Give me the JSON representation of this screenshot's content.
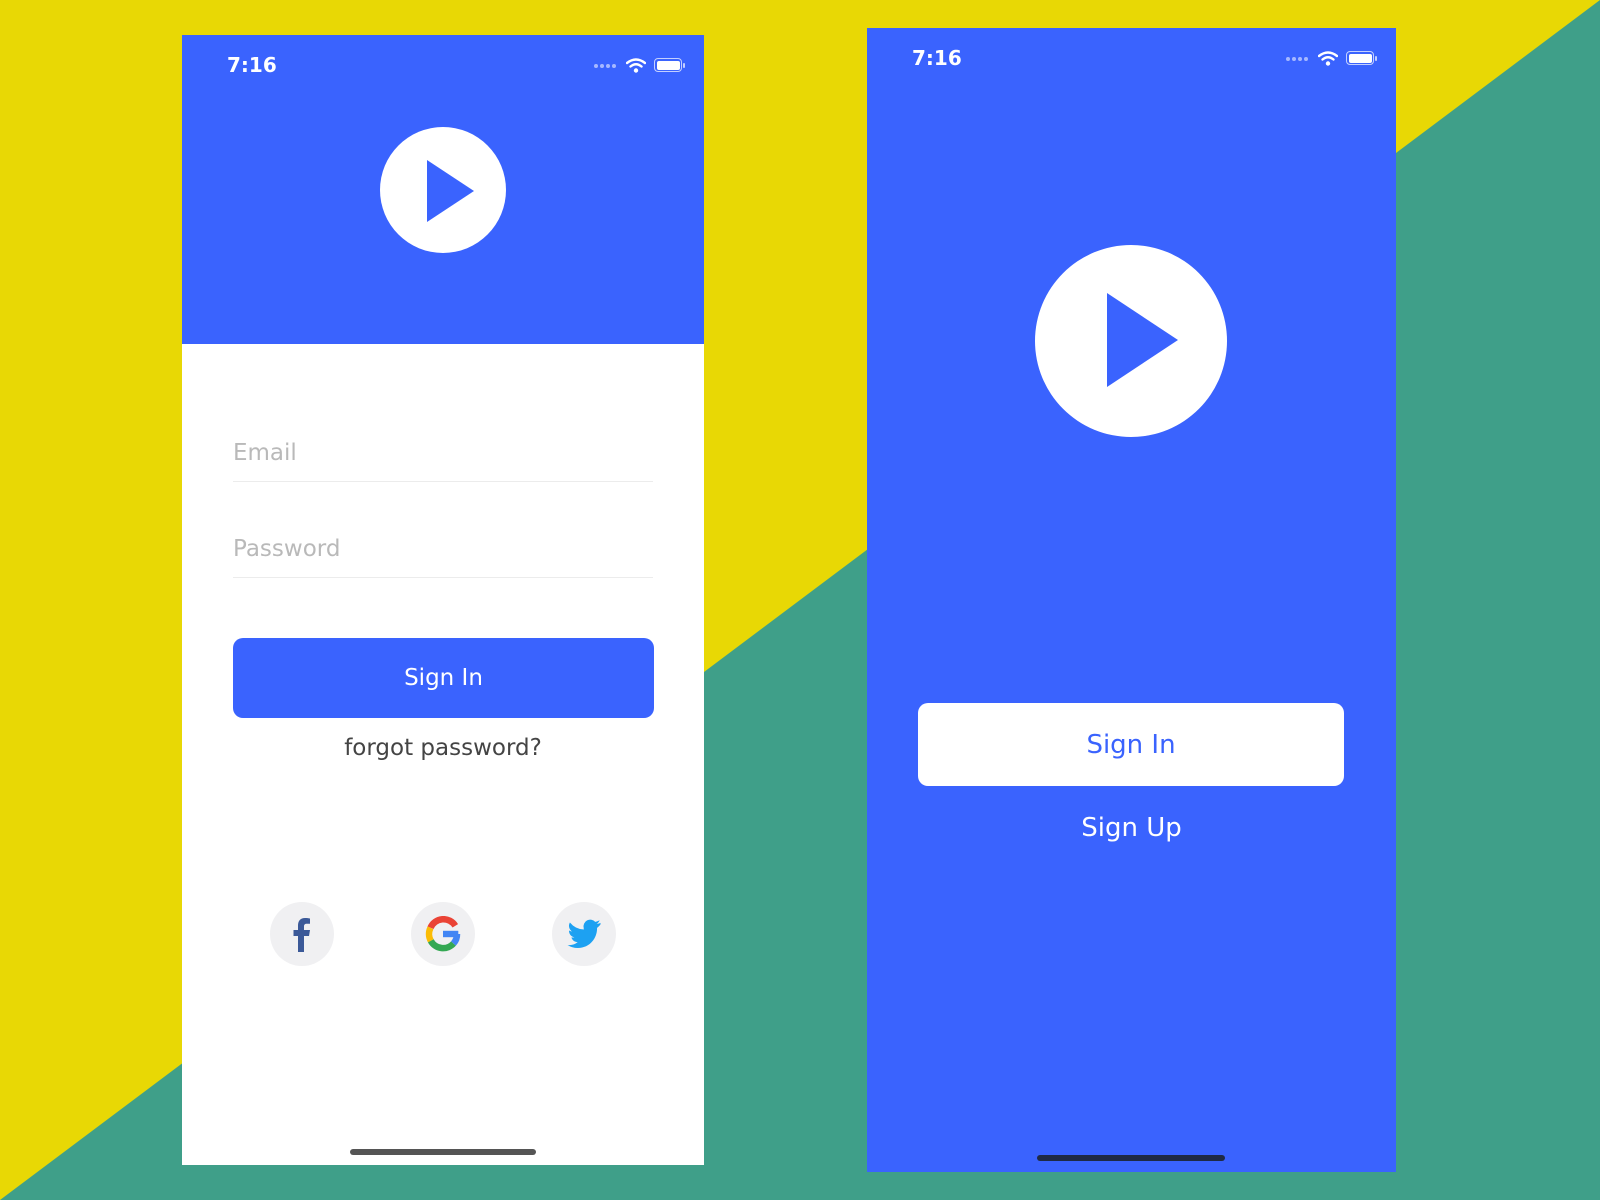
{
  "colors": {
    "brand_blue": "#3a63fe",
    "background_yellow": "#e8d805",
    "background_teal": "#3f9f89",
    "white": "#ffffff",
    "placeholder_gray": "#b9b9b9",
    "text_dark": "#444444"
  },
  "login_screen": {
    "status_bar": {
      "time": "7:16",
      "icons": [
        "signal-dots-icon",
        "wifi-icon",
        "battery-icon"
      ]
    },
    "logo": {
      "icon": "play-icon"
    },
    "email_field": {
      "value": "",
      "placeholder": "Email"
    },
    "password_field": {
      "value": "",
      "placeholder": "Password"
    },
    "sign_in_label": "Sign In",
    "forgot_password_label": "forgot password?",
    "social": [
      {
        "icon": "facebook-icon"
      },
      {
        "icon": "google-icon"
      },
      {
        "icon": "twitter-icon"
      }
    ]
  },
  "welcome_screen": {
    "status_bar": {
      "time": "7:16",
      "icons": [
        "signal-dots-icon",
        "wifi-icon",
        "battery-icon"
      ]
    },
    "logo": {
      "icon": "play-icon"
    },
    "sign_in_label": "Sign In",
    "sign_up_label": "Sign Up"
  }
}
